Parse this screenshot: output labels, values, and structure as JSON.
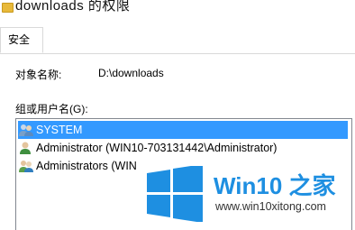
{
  "window": {
    "title": "downloads 的权限"
  },
  "tabs": [
    {
      "label": "安全"
    }
  ],
  "security": {
    "object_label": "对象名称:",
    "object_value": "D:\\downloads",
    "group_label": "组或用户名(G):",
    "users": [
      {
        "name": "SYSTEM",
        "selected": true
      },
      {
        "name": "Administrator (WIN10-703131442\\Administrator)",
        "selected": false
      },
      {
        "name": "Administrators (WIN",
        "selected": false
      }
    ]
  },
  "watermark": {
    "brand": "Win10 之家",
    "site": "www.win10xitong.com"
  },
  "colors": {
    "selection": "#3399ff",
    "brand_blue": "#1e8fe1"
  },
  "icons": {
    "folder": "folder-icon",
    "users": "users-group-icon",
    "user": "user-icon",
    "windows": "windows-logo-icon"
  }
}
